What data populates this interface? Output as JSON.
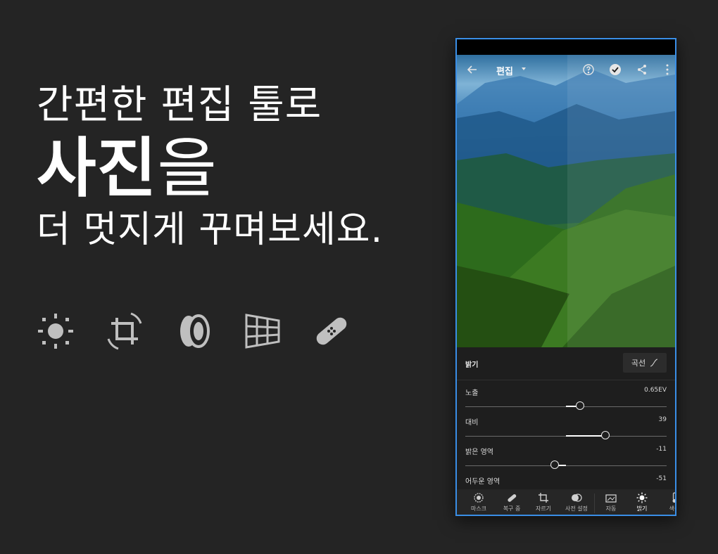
{
  "hero": {
    "line1": "간편한 편집 툴로",
    "line2_strong": "사진",
    "line2_light": "을",
    "line3": "더 멋지게 꾸며보세요."
  },
  "tools": [
    {
      "icon": "sun-icon"
    },
    {
      "icon": "crop-rotate-icon"
    },
    {
      "icon": "lens-icon"
    },
    {
      "icon": "perspective-grid-icon"
    },
    {
      "icon": "bandage-icon"
    }
  ],
  "phone": {
    "title": "편집",
    "panel": {
      "section": "밝기",
      "curve_button": "곡선",
      "sliders": [
        {
          "name": "노출",
          "value": "0.65EV",
          "position": 0.57
        },
        {
          "name": "대비",
          "value": "39",
          "position": 0.695
        },
        {
          "name": "밝은 영역",
          "value": "-11",
          "position": 0.445
        },
        {
          "name": "어두운 영역",
          "value": "-51",
          "position": 0.25
        }
      ]
    },
    "nav": [
      {
        "label": "마스크",
        "icon": "mask-icon"
      },
      {
        "label": "복구 중",
        "icon": "bandage-icon"
      },
      {
        "label": "자르기",
        "icon": "crop-icon"
      },
      {
        "label": "사전 설정",
        "icon": "presets-icon"
      },
      {
        "label": "자동",
        "icon": "auto-icon"
      },
      {
        "label": "밝기",
        "icon": "sun-icon"
      },
      {
        "label": "색상",
        "icon": "thermometer-icon"
      }
    ],
    "accent_color": "#3a8ee6"
  }
}
